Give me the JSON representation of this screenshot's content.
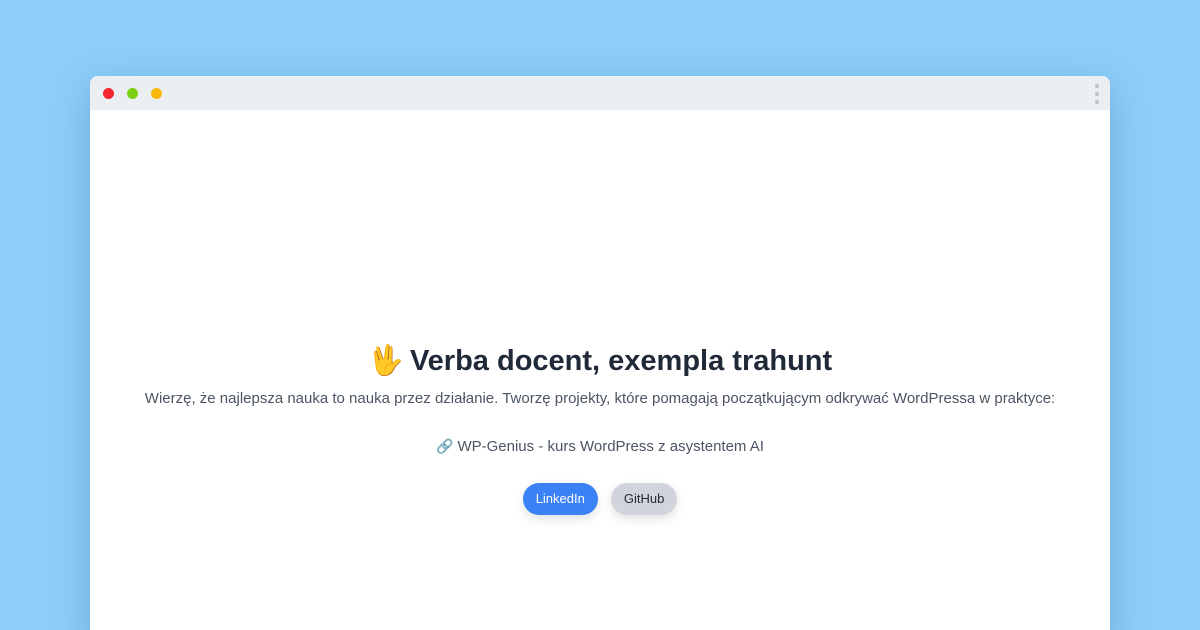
{
  "window": {
    "traffic_lights": [
      "red",
      "green",
      "yellow"
    ],
    "menu_icon": "vertical-dots-icon"
  },
  "hero": {
    "emoji": "🖖",
    "title": "Verba docent, exempla trahunt",
    "intro": "Wierzę, że najlepsza nauka to nauka przez działanie. Tworzę projekty, które pomagają początkującym odkrywać WordPressa w praktyce:"
  },
  "project": {
    "icon": "🔗",
    "label": "WP-Genius - kurs WordPress z asystentem AI"
  },
  "buttons": {
    "linkedin": "LinkedIn",
    "github": "GitHub"
  },
  "colors": {
    "background": "#8ecff9",
    "primary_button": "#3b82f6",
    "secondary_button": "#d1d5db",
    "heading": "#1f2937",
    "text": "#4b5563"
  }
}
